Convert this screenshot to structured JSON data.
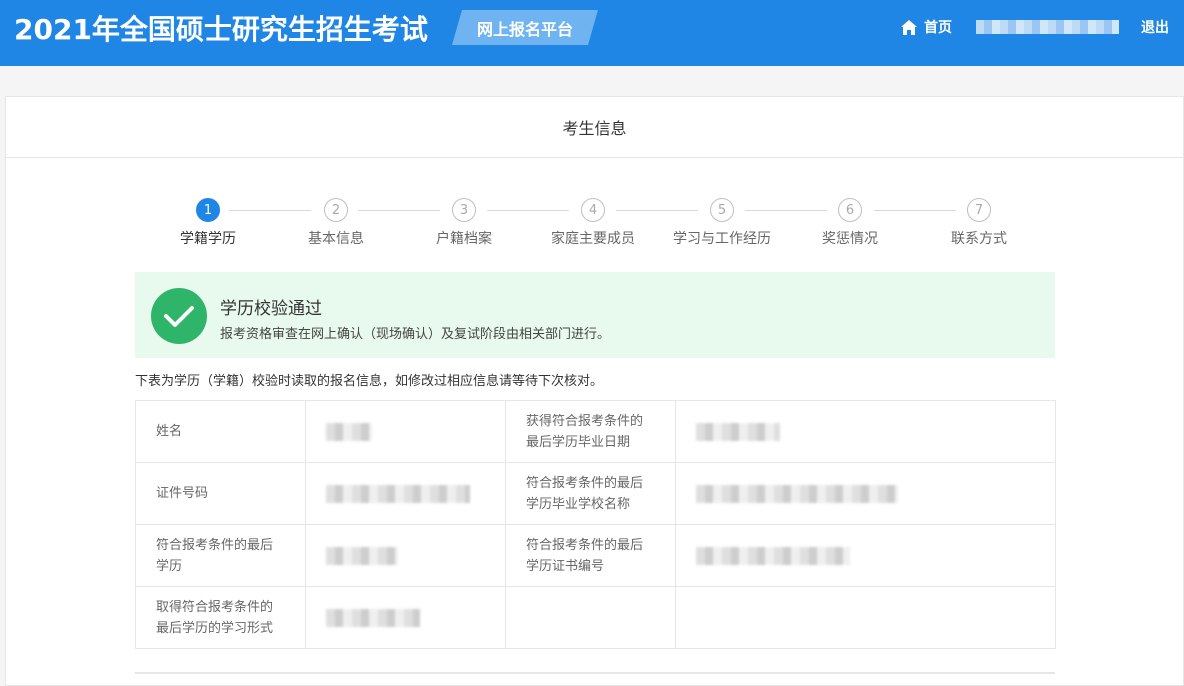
{
  "header": {
    "title": "2021年全国硕士研究生招生考试",
    "platform": "网上报名平台",
    "home_label": "首页",
    "home_icon": "home-icon",
    "logout_label": "退出",
    "bg_color": "#1f86e6"
  },
  "panel": {
    "title": "考生信息"
  },
  "steps": [
    {
      "number": "1",
      "label": "学籍学历",
      "active": true
    },
    {
      "number": "2",
      "label": "基本信息",
      "active": false
    },
    {
      "number": "3",
      "label": "户籍档案",
      "active": false
    },
    {
      "number": "4",
      "label": "家庭主要成员",
      "active": false
    },
    {
      "number": "5",
      "label": "学习与工作经历",
      "active": false
    },
    {
      "number": "6",
      "label": "奖惩情况",
      "active": false
    },
    {
      "number": "7",
      "label": "联系方式",
      "active": false
    }
  ],
  "success": {
    "title": "学历校验通过",
    "description": "报考资格审查在网上确认（现场确认）及复试阶段由相关部门进行。",
    "icon": "check-circle-icon",
    "color": "#2fb56a"
  },
  "table": {
    "note": "下表为学历（学籍）校验时读取的报名信息，如修改过相应信息请等待下次核对。",
    "rows": [
      {
        "left_label": "姓名",
        "right_label": "获得符合报考条件的最后学历毕业日期"
      },
      {
        "left_label": "证件号码",
        "right_label": "符合报考条件的最后学历毕业学校名称"
      },
      {
        "left_label": "符合报考条件的最后学历",
        "right_label": "符合报考条件的最后学历证书编号"
      },
      {
        "left_label": "取得符合报考条件的最后学历的学习形式",
        "right_label": ""
      }
    ]
  }
}
